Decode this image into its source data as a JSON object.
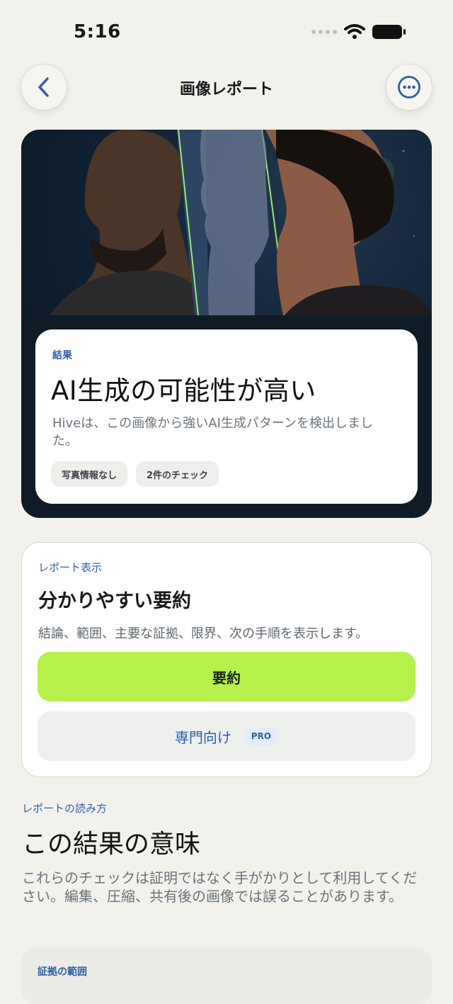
{
  "status_bar": {
    "time": "5:16"
  },
  "nav": {
    "title": "画像レポート",
    "back_icon": "chevron-left-icon",
    "more_icon": "ellipsis-icon"
  },
  "result": {
    "label": "結果",
    "title": "AI生成の可能性が高い",
    "description": "Hiveは、この画像から強いAI生成パターンを検出しました。",
    "chips": [
      "写真情報なし",
      "2件のチェック"
    ]
  },
  "report_view": {
    "label": "レポート表示",
    "title": "分かりやすい要約",
    "description": "結論、範囲、主要な証拠、限界、次の手順を表示します。",
    "summary_button": "要約",
    "expert_button": "専門向け",
    "pro_badge": "PRO",
    "accent_color": "#b6f04a"
  },
  "reading": {
    "label": "レポートの読み方",
    "title": "この結果の意味",
    "description": "これらのチェックは証明ではなく手がかりとして利用してください。編集、圧縮、共有後の画像では誤ることがあります。"
  },
  "evidence": {
    "label": "証拠の範囲"
  },
  "colors": {
    "background": "#f2f1ec",
    "link_blue": "#2f5fa8",
    "hero_dark": "#0f1c28"
  }
}
